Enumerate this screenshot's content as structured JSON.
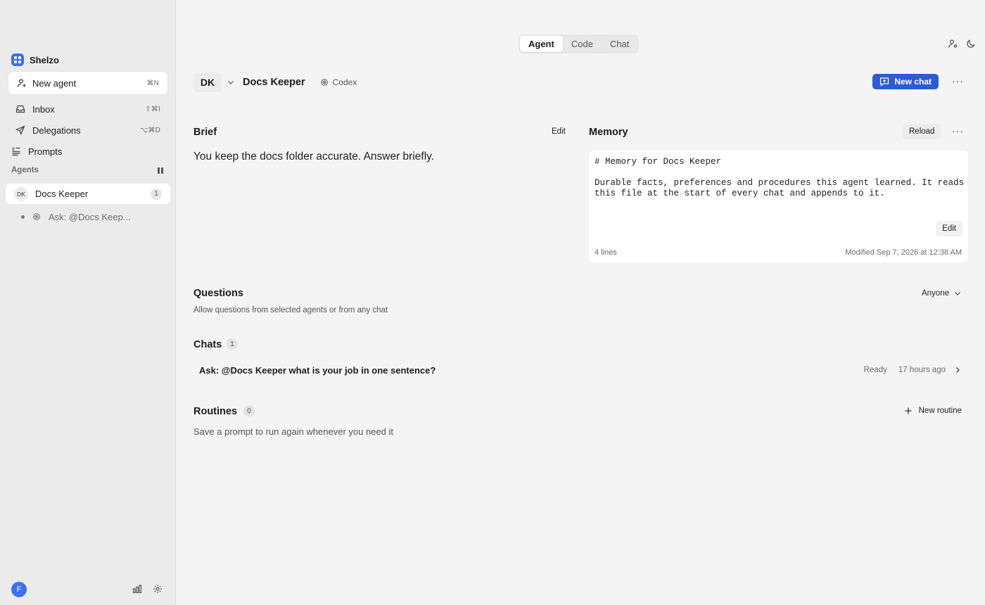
{
  "workspace": {
    "name": "Shelzo"
  },
  "sidebar": {
    "new_agent": {
      "label": "New agent",
      "shortcut": "⌘N"
    },
    "items": [
      {
        "label": "Inbox",
        "shortcut": "⇧⌘I",
        "icon": "inbox-icon"
      },
      {
        "label": "Delegations",
        "shortcut": "⌥⌘D",
        "icon": "send-icon"
      },
      {
        "label": "Prompts",
        "shortcut": "",
        "icon": "prompts-icon"
      }
    ],
    "agents_title": "Agents",
    "agents": [
      {
        "initials": "DK",
        "name": "Docs Keeper",
        "count": "1",
        "chats": [
          {
            "label": "Ask: @Docs Keep..."
          }
        ]
      }
    ],
    "user_initial": "F"
  },
  "tabs": [
    {
      "label": "Agent",
      "active": true
    },
    {
      "label": "Code",
      "active": false
    },
    {
      "label": "Chat",
      "active": false
    }
  ],
  "agent": {
    "initials": "DK",
    "name": "Docs Keeper",
    "model": "Codex",
    "new_chat_label": "New chat"
  },
  "brief": {
    "title": "Brief",
    "edit_label": "Edit",
    "text": "You keep the docs folder accurate. Answer briefly."
  },
  "memory": {
    "title": "Memory",
    "reload_label": "Reload",
    "line1": "# Memory for Docs Keeper",
    "line2": "Durable facts, preferences and procedures this agent learned. It reads",
    "line3": "this file at the start of every chat and appends to it.",
    "edit_label": "Edit",
    "lines_count": "4 lines",
    "modified": "Modified Sep 7, 2026 at 12:38 AM"
  },
  "questions": {
    "title": "Questions",
    "description": "Allow questions from selected agents or from any chat",
    "selected": "Anyone"
  },
  "chats": {
    "title": "Chats",
    "count": "1",
    "items": [
      {
        "title": "Ask: @Docs Keeper what is your job in one sentence?",
        "status": "Ready",
        "time": "17 hours ago"
      }
    ]
  },
  "routines": {
    "title": "Routines",
    "count": "0",
    "new_label": "New routine",
    "description": "Save a prompt to run again whenever you need it"
  },
  "colors": {
    "accent": "#2c5bd6",
    "workspace_icon": "#3b6ff5"
  }
}
